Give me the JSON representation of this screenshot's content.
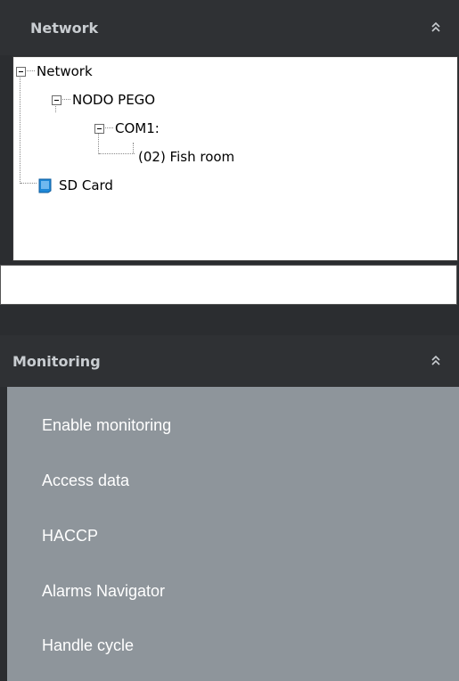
{
  "network_section": {
    "title": "Network",
    "collapse_icon": "double-chevron-up-icon"
  },
  "tree": {
    "root_label": "Network",
    "node_label": "NODO PEGO",
    "port_label": "COM1:",
    "device_label": "(02) Fish room",
    "sd_label": "SD Card"
  },
  "search": {
    "value": ""
  },
  "monitoring_section": {
    "title": "Monitoring",
    "collapse_icon": "double-chevron-up-icon",
    "items": [
      {
        "label": "Enable monitoring"
      },
      {
        "label": "Access data"
      },
      {
        "label": "HACCP"
      },
      {
        "label": "Alarms Navigator"
      },
      {
        "label": "Handle cycle"
      }
    ]
  },
  "colors": {
    "panel_bg": "#2b2d30",
    "header_text": "#c9cdd1",
    "menu_bg": "#8e959b",
    "menu_text": "#ffffff",
    "sd_icon": "#1e88d8"
  }
}
